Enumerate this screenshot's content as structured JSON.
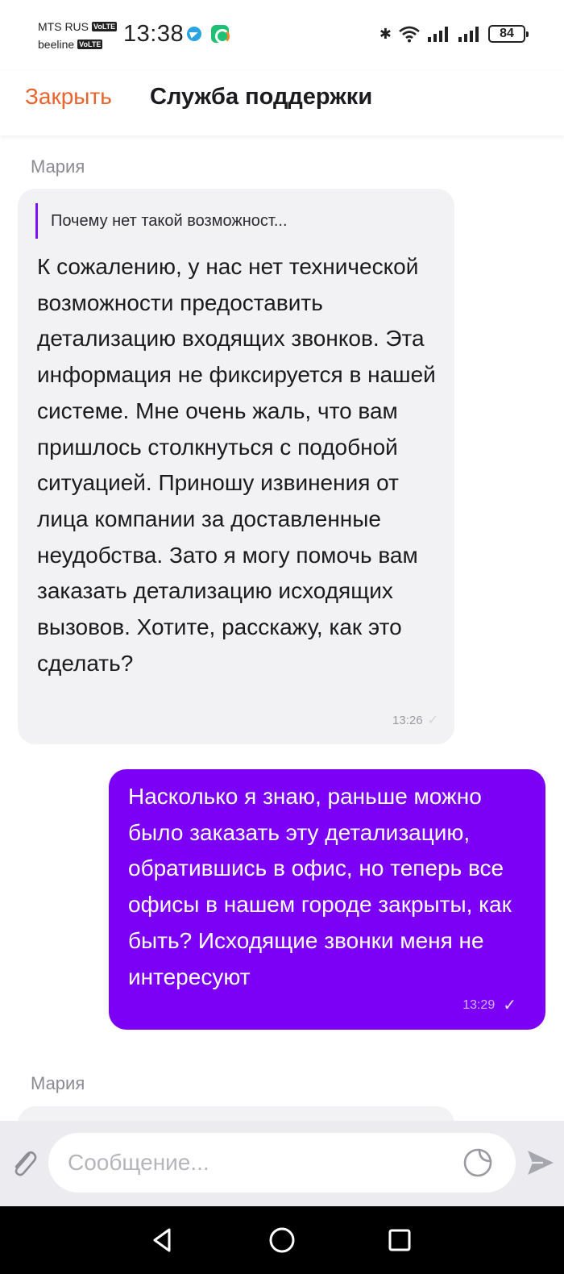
{
  "status_bar": {
    "carrier1": "MTS RUS",
    "carrier2": "beeline",
    "volte": "VoLTE",
    "time": "13:38",
    "battery": "84",
    "icons": [
      "telegram-icon",
      "app-notification-icon",
      "bluetooth-icon",
      "wifi-icon",
      "signal-icon",
      "signal-icon",
      "battery-icon"
    ]
  },
  "header": {
    "close_label": "Закрыть",
    "title": "Служба поддержки"
  },
  "messages": [
    {
      "direction": "incoming",
      "sender": "Мария",
      "quote": "Почему нет такой возможност...",
      "text": "К сожалению, у нас нет технической возможности предоставить детализацию входящих звонков. Эта информация не фиксируется в нашей системе. Мне очень жаль, что вам пришлось столкнуться с подобной ситуацией. Приношу извинения от лица компании за доставленные неудобства. Зато я могу помочь вам заказать детализацию исходящих вызовов. Хотите, расскажу, как это сделать?",
      "time": "13:26"
    },
    {
      "direction": "outgoing",
      "text": "Насколько я знаю, раньше можно было заказать эту детализацию, обратившись в офис, но теперь все офисы в нашем городе закрыты, как быть? Исходящие звонки меня не интересуют",
      "time": "13:29"
    },
    {
      "direction": "incoming",
      "sender": "Мария"
    }
  ],
  "input": {
    "placeholder": "Сообщение..."
  },
  "colors": {
    "accent_close": "#e8642c",
    "outgoing_bubble": "#7b00f5",
    "incoming_bubble": "#f2f2f4",
    "quote_bar": "#7b12f5"
  }
}
